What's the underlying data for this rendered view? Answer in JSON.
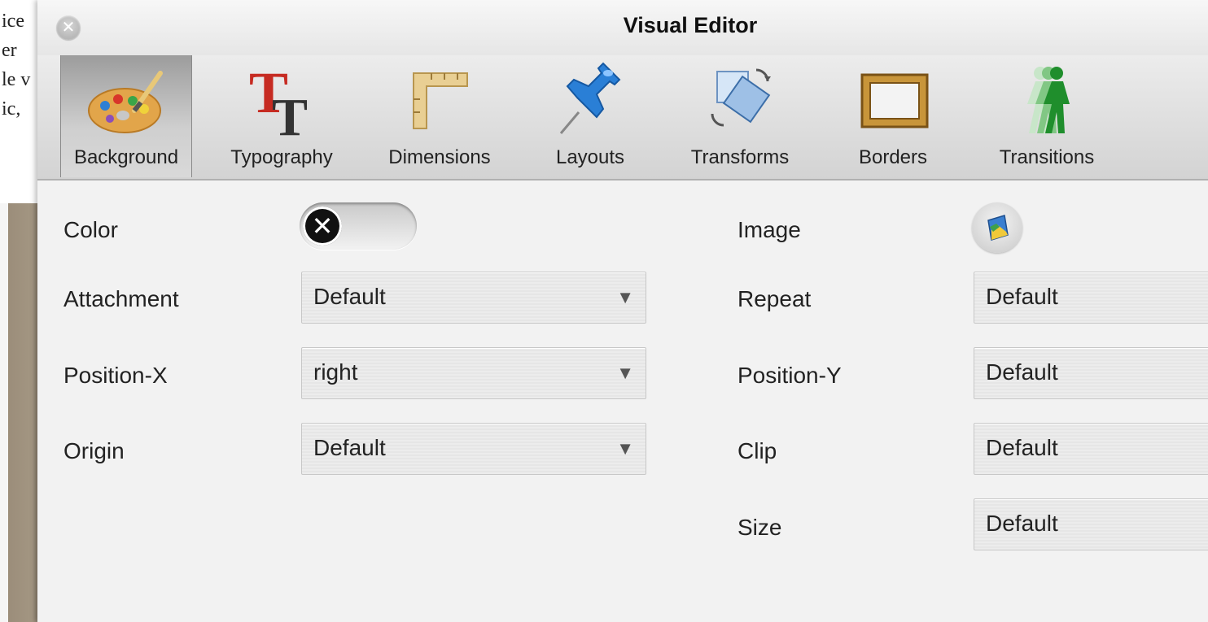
{
  "background_page": {
    "lines": [
      "ice",
      "er",
      "le v",
      "ic,"
    ]
  },
  "window": {
    "title": "Visual Editor",
    "close_icon": "close-icon"
  },
  "toolbar": {
    "items": [
      {
        "label": "Background",
        "icon": "palette-icon",
        "active": true
      },
      {
        "label": "Typography",
        "icon": "typography-icon",
        "active": false
      },
      {
        "label": "Dimensions",
        "icon": "ruler-corner-icon",
        "active": false
      },
      {
        "label": "Layouts",
        "icon": "pushpin-icon",
        "active": false
      },
      {
        "label": "Transforms",
        "icon": "rotate-icon",
        "active": false
      },
      {
        "label": "Borders",
        "icon": "frame-icon",
        "active": false
      },
      {
        "label": "Transitions",
        "icon": "walking-person-icon",
        "active": false
      }
    ]
  },
  "form": {
    "color": {
      "label": "Color",
      "toggle_on": false,
      "knob_glyph": "✕"
    },
    "image": {
      "label": "Image",
      "icon": "image-picker-icon"
    },
    "attachment": {
      "label": "Attachment",
      "value": "Default"
    },
    "repeat": {
      "label": "Repeat",
      "value": "Default"
    },
    "position_x": {
      "label": "Position-X",
      "value": "right"
    },
    "position_y": {
      "label": "Position-Y",
      "value": "Default"
    },
    "origin": {
      "label": "Origin",
      "value": "Default"
    },
    "clip": {
      "label": "Clip",
      "value": "Default"
    },
    "size": {
      "label": "Size",
      "value": "Default"
    },
    "dropdown_arrow": "▼"
  }
}
